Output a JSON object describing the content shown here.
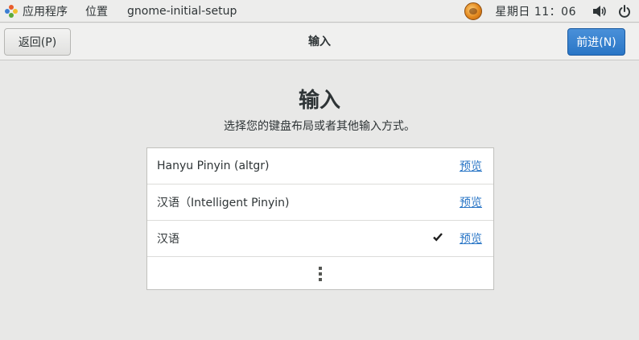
{
  "topbar": {
    "apps_label": "应用程序",
    "places_label": "位置",
    "active_app": "gnome-initial-setup",
    "clock": "星期日 11：06"
  },
  "header": {
    "back_label": "返回(P)",
    "title": "输入",
    "next_label": "前进(N)"
  },
  "page": {
    "title": "输入",
    "description": "选择您的键盘布局或者其他输入方式。"
  },
  "input_sources": [
    {
      "label": "Hanyu Pinyin (altgr)",
      "preview": "预览",
      "selected": false
    },
    {
      "label": "汉语（Intelligent Pinyin)",
      "preview": "预览",
      "selected": false
    },
    {
      "label": "汉语",
      "preview": "预览",
      "selected": true
    }
  ],
  "colors": {
    "accent": "#2a76c6",
    "background": "#e8e8e7"
  },
  "icons": {
    "apps": "apps-icon",
    "avatar": "user-avatar-icon",
    "volume": "volume-icon",
    "power": "power-icon",
    "check": "check-icon",
    "more": "more-vertical-icon"
  }
}
